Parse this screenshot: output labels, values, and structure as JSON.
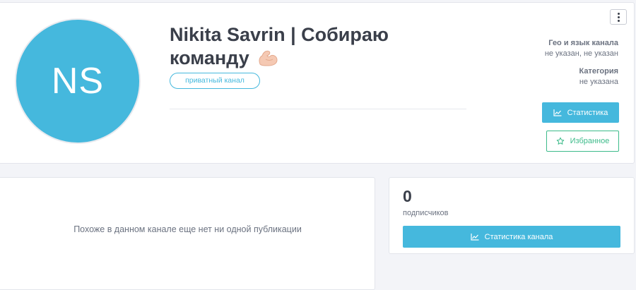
{
  "profile": {
    "avatar_initials": "NS",
    "title": "Nikita Savrin | Собираю команду",
    "title_emoji_icon": "flexed-biceps-icon",
    "private_badge": "приватный канал",
    "geo_label": "Гео и язык канала",
    "geo_value": "не указан, не указан",
    "category_label": "Категория",
    "category_value": "не указана",
    "stats_button": "Статистика",
    "favorite_button": "Избранное",
    "menu_icon": "vertical-ellipsis-icon"
  },
  "posts": {
    "empty_message": "Похоже в данном канале еще нет ни одной публикации"
  },
  "stats": {
    "subscribers_count": "0",
    "subscribers_label": "подписчиков",
    "channel_stats_button": "Статистика канала"
  },
  "colors": {
    "accent": "#45b8dd",
    "favorite": "#3dbb8a",
    "background": "#f3f4f8",
    "text": "#3a3f4a"
  }
}
